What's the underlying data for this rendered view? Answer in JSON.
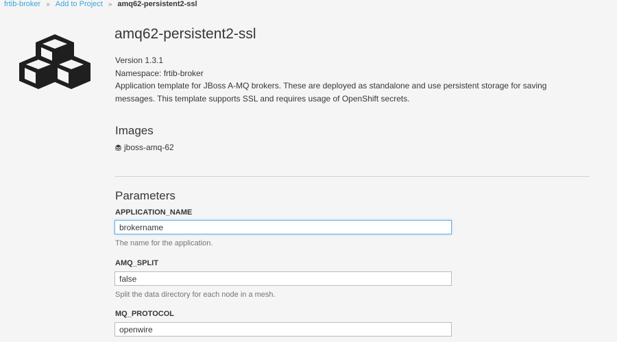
{
  "breadcrumb": {
    "items": [
      "frtib-broker",
      "Add to Project"
    ],
    "separator": "»",
    "current": "amq62-persistent2-ssl"
  },
  "template": {
    "title": "amq62-persistent2-ssl",
    "version": "Version 1.3.1",
    "namespace": "Namespace: frtib-broker",
    "description": "Application template for JBoss A-MQ brokers. These are deployed as standalone and use persistent storage for saving messages. This template supports SSL and requires usage of OpenShift secrets.",
    "logo_icon": "cubes-icon"
  },
  "images": {
    "heading": "Images",
    "items": [
      {
        "name": "jboss-amq-62",
        "icon": "stack-icon"
      }
    ]
  },
  "parameters": {
    "heading": "Parameters",
    "items": [
      {
        "label": "APPLICATION_NAME",
        "value": "brokername",
        "help": "The name for the application."
      },
      {
        "label": "AMQ_SPLIT",
        "value": "false",
        "help": "Split the data directory for each node in a mesh."
      },
      {
        "label": "MQ_PROTOCOL",
        "value": "openwire",
        "help": ""
      }
    ]
  },
  "colors": {
    "link": "#39a5dc",
    "text": "#363636",
    "background": "#f5f5f5",
    "focus_border": "#66afe9"
  }
}
